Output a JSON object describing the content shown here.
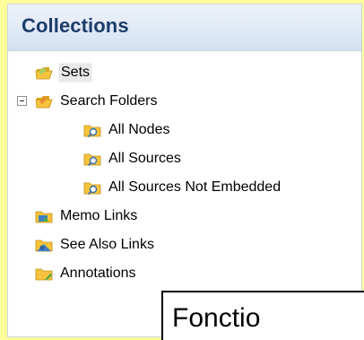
{
  "colors": {
    "background": "#ffff9c",
    "header_text": "#1d3c6a",
    "folder": "#f5c43c"
  },
  "panel": {
    "title": "Collections"
  },
  "tree": {
    "items": [
      {
        "label": "Sets",
        "icon": "folder-open-icon",
        "selected": true
      },
      {
        "label": "Search Folders",
        "icon": "search-folder-open-icon",
        "expanded": true
      },
      {
        "label": "All Nodes",
        "icon": "search-folder-icon"
      },
      {
        "label": "All Sources",
        "icon": "search-folder-icon"
      },
      {
        "label": "All Sources Not Embedded",
        "icon": "search-folder-icon"
      },
      {
        "label": "Memo Links",
        "icon": "memo-links-icon"
      },
      {
        "label": "See Also Links",
        "icon": "see-also-links-icon"
      },
      {
        "label": "Annotations",
        "icon": "annotations-icon"
      }
    ]
  },
  "callout": {
    "text": "Fonctio"
  }
}
